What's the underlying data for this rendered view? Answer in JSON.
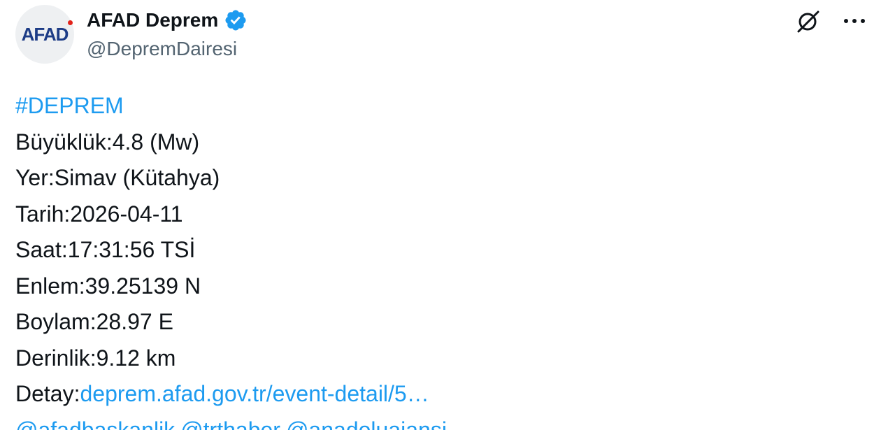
{
  "author": {
    "avatar_text": "AFAD",
    "display_name": "AFAD Deprem",
    "handle": "@DepremDairesi",
    "verified_color": "#1d9bf0"
  },
  "actions": {
    "grok_icon": "grok-icon",
    "more_icon": "more-horizontal-icon"
  },
  "tweet": {
    "hashtag": "#DEPREM",
    "lines": [
      "Büyüklük:4.8 (Mw)",
      "Yer:Simav (Kütahya)",
      "Tarih:2026-04-11",
      "Saat:17:31:56 TSİ",
      "Enlem:39.25139 N",
      "Boylam:28.97 E",
      "Derinlik:9.12 km"
    ],
    "detail_label": "Detay:",
    "detail_link": "deprem.afad.gov.tr/event-detail/5…",
    "mentions": [
      "@afadbaskanlik",
      "@trthaber",
      "@anadoluajansi"
    ]
  },
  "colors": {
    "link": "#1d9bf0",
    "text": "#0f1419",
    "secondary": "#536471"
  }
}
